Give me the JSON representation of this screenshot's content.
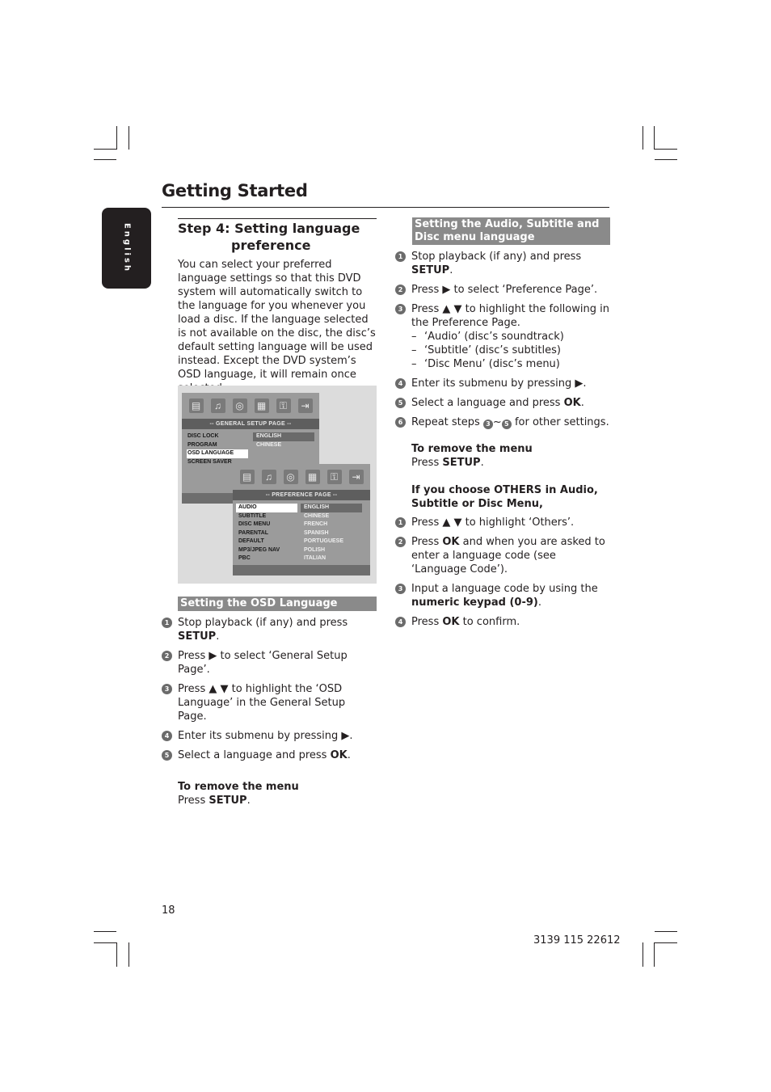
{
  "page": {
    "title": "Getting Started",
    "side_tab": "English",
    "page_number": "18",
    "doc_code": "3139 115 22612"
  },
  "left": {
    "heading_line1": "Step 4: Setting language",
    "heading_line2": "preference",
    "intro": "You can select your preferred language settings so that this DVD system will automatically switch to the language for you whenever you load a disc.  If the language selected is not available on the disc, the disc’s default setting language will be used instead.  Except the DVD system’s OSD language, it will remain once selected.",
    "section_title": "Setting the OSD Language",
    "steps": [
      {
        "num": "1",
        "pre": "Stop playback (if any) and press ",
        "bold": "SETUP",
        "post": "."
      },
      {
        "num": "2",
        "pre": "Press ▶ to select ‘General Setup Page’.",
        "bold": "",
        "post": ""
      },
      {
        "num": "3",
        "pre": "Press ▲ ▼ to highlight the ‘OSD Language’ in the General Setup Page.",
        "bold": "",
        "post": ""
      },
      {
        "num": "4",
        "pre": "Enter its submenu by pressing ▶.",
        "bold": "",
        "post": ""
      },
      {
        "num": "5",
        "pre": "Select a language and press ",
        "bold": "OK",
        "post": "."
      }
    ],
    "remove_heading": "To remove the menu",
    "remove_pre": "Press ",
    "remove_bold": "SETUP",
    "remove_post": "."
  },
  "figure": {
    "general": {
      "icons": [
        "tv-setup-icon",
        "audio-speaker-icon",
        "disc-icon",
        "preference-screen-icon",
        "lock-icon",
        "exit-door-icon"
      ],
      "banner": "-- GENERAL SETUP PAGE --",
      "items": [
        "DISC LOCK",
        "PROGRAM",
        "OSD LANGUAGE",
        "SCREEN SAVER"
      ],
      "selected_item": "OSD LANGUAGE",
      "options": [
        "ENGLISH",
        "CHINESE"
      ],
      "selected_option": "ENGLISH"
    },
    "preference": {
      "icons": [
        "tv-setup-icon",
        "audio-speaker-icon",
        "disc-icon",
        "preference-screen-icon",
        "lock-icon",
        "exit-door-icon"
      ],
      "banner": "-- PREFERENCE PAGE --",
      "items": [
        "AUDIO",
        "SUBTITLE",
        "DISC MENU",
        "PARENTAL",
        "DEFAULT",
        "MP3/JPEG NAV",
        "PBC"
      ],
      "selected_item": "AUDIO",
      "options": [
        "ENGLISH",
        "CHINESE",
        "FRENCH",
        "SPANISH",
        "PORTUGUESE",
        "POLISH",
        "ITALIAN"
      ],
      "selected_option": "ENGLISH"
    }
  },
  "right": {
    "section_title": "Setting the Audio, Subtitle and Disc menu language",
    "steps": [
      {
        "num": "1",
        "pre": "Stop playback (if any) and press ",
        "bold": "SETUP",
        "post": "."
      },
      {
        "num": "2",
        "pre": "Press ▶ to select ‘Preference Page’.",
        "bold": "",
        "post": ""
      },
      {
        "num": "3",
        "pre": "Press ▲ ▼ to highlight the following in the Preference Page.",
        "bold": "",
        "post": ""
      },
      {
        "num": "4",
        "pre": "Enter its submenu by pressing ▶.",
        "bold": "",
        "post": ""
      },
      {
        "num": "5",
        "pre": "Select a language and press ",
        "bold": "OK",
        "post": "."
      },
      {
        "num": "6",
        "pre": "Repeat steps ",
        "bold": "",
        "post": " for other settings."
      }
    ],
    "sub_items": [
      "‘Audio’ (disc’s soundtrack)",
      "‘Subtitle’ (disc’s subtitles)",
      "‘Disc Menu’ (disc’s menu)"
    ],
    "repeat_from": "3",
    "repeat_to": "5",
    "repeat_sep": "~",
    "remove_heading": "To remove the menu",
    "remove_pre": "Press ",
    "remove_bold": "SETUP",
    "remove_post": ".",
    "others_heading": "If you choose OTHERS in Audio, Subtitle or Disc Menu,",
    "others_steps": [
      {
        "num": "1",
        "pre": "Press ▲ ▼ to highlight ‘Others’.",
        "bold": "",
        "post": ""
      },
      {
        "num": "2",
        "pre": "Press ",
        "bold": "OK",
        "post": " and when you are asked to enter a language code (see ‘Language Code’)."
      },
      {
        "num": "3",
        "pre": "Input a language code by using the ",
        "bold": "numeric keypad (0-9)",
        "post": "."
      },
      {
        "num": "4",
        "pre": "Press ",
        "bold": "OK",
        "post": " to confirm."
      }
    ]
  },
  "colors": {
    "ink": "#231f20",
    "section_bar": "#8a8a8a",
    "osd_bg": "#9b9b9b",
    "osd_banner": "#5e5e5e",
    "figure_bg": "#dcdcdc"
  }
}
